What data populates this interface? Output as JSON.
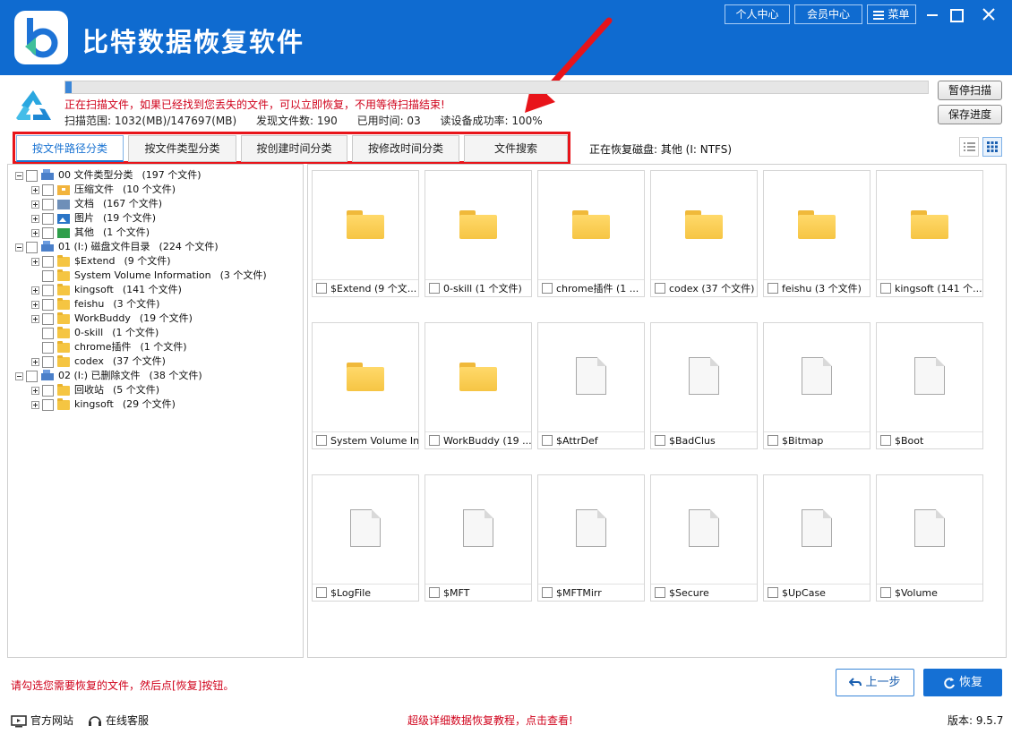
{
  "app": {
    "title": "比特数据恢复软件"
  },
  "titlebar": {
    "personal_center": "个人中心",
    "member_center": "会员中心",
    "menu": "菜单"
  },
  "scan": {
    "progress": 0.007,
    "message": "正在扫描文件，如果已经找到您丢失的文件，可以立即恢复，不用等待扫描结束!",
    "range": "扫描范围: 1032(MB)/147697(MB)",
    "found": "发现文件数: 190",
    "elapsed": "已用时间: 03",
    "read_rate": "读设备成功率: 100%",
    "pause_label": "暂停扫描",
    "save_label": "保存进度"
  },
  "tabs": [
    {
      "label": "按文件路径分类"
    },
    {
      "label": "按文件类型分类"
    },
    {
      "label": "按创建时间分类"
    },
    {
      "label": "按修改时间分类"
    },
    {
      "label": "文件搜索"
    }
  ],
  "recovering_disk": "正在恢复磁盘: 其他 (I: NTFS)",
  "tree": [
    {
      "name": "00 文件类型分类",
      "count": "(197 个文件)"
    },
    {
      "name": "压缩文件",
      "count": "(10 个文件)"
    },
    {
      "name": "文档",
      "count": "(167 个文件)"
    },
    {
      "name": "图片",
      "count": "(19 个文件)"
    },
    {
      "name": "其他",
      "count": "(1 个文件)"
    },
    {
      "name": "01 (I:) 磁盘文件目录",
      "count": "(224 个文件)"
    },
    {
      "name": "$Extend",
      "count": "(9 个文件)"
    },
    {
      "name": "System Volume Information",
      "count": "(3 个文件)"
    },
    {
      "name": "kingsoft",
      "count": "(141 个文件)"
    },
    {
      "name": "feishu",
      "count": "(3 个文件)"
    },
    {
      "name": "WorkBuddy",
      "count": "(19 个文件)"
    },
    {
      "name": "0-skill",
      "count": "(1 个文件)"
    },
    {
      "name": "chrome插件",
      "count": "(1 个文件)"
    },
    {
      "name": "codex",
      "count": "(37 个文件)"
    },
    {
      "name": "02 (I:) 已删除文件",
      "count": "(38 个文件)"
    },
    {
      "name": "回收站",
      "count": "(5 个文件)"
    },
    {
      "name": "kingsoft",
      "count": "(29 个文件)"
    }
  ],
  "grid": [
    {
      "label": "$Extend  (9 个文...",
      "kind": "folder"
    },
    {
      "label": "0-skill  (1 个文件)",
      "kind": "folder"
    },
    {
      "label": "chrome插件  (1 ...",
      "kind": "folder"
    },
    {
      "label": "codex  (37 个文件)",
      "kind": "folder"
    },
    {
      "label": "feishu  (3 个文件)",
      "kind": "folder"
    },
    {
      "label": "kingsoft  (141 个...",
      "kind": "folder"
    },
    {
      "label": "System Volume In...",
      "kind": "folder"
    },
    {
      "label": "WorkBuddy  (19 ...",
      "kind": "folder"
    },
    {
      "label": "$AttrDef",
      "kind": "file"
    },
    {
      "label": "$BadClus",
      "kind": "file"
    },
    {
      "label": "$Bitmap",
      "kind": "file"
    },
    {
      "label": "$Boot",
      "kind": "file"
    },
    {
      "label": "$LogFile",
      "kind": "file"
    },
    {
      "label": "$MFT",
      "kind": "file"
    },
    {
      "label": "$MFTMirr",
      "kind": "file"
    },
    {
      "label": "$Secure",
      "kind": "file"
    },
    {
      "label": "$UpCase",
      "kind": "file"
    },
    {
      "label": "$Volume",
      "kind": "file"
    }
  ],
  "footer": {
    "hint": "请勾选您需要恢复的文件，然后点[恢复]按钮。",
    "prev_label": "上一步",
    "recover_label": "恢复",
    "website": "官方网站",
    "support": "在线客服",
    "tutorial": "超级详细数据恢复教程，点击查看!",
    "version": "版本: 9.5.7"
  },
  "colors": {
    "brand": "#0f6bd0",
    "warning": "#d0021b",
    "highlight": "#e8141a"
  }
}
